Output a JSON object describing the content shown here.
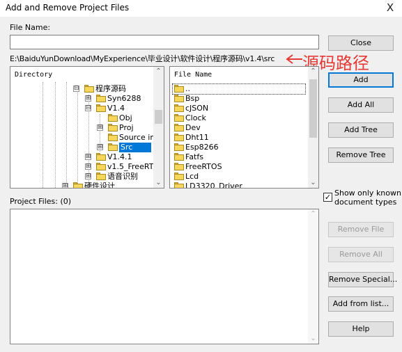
{
  "window": {
    "title": "Add and Remove Project Files",
    "close_glyph": "X"
  },
  "file_name": {
    "label": "File Name:",
    "value": ""
  },
  "path": {
    "text": "E:\\BaiduYunDownload\\MyExperience\\毕业设计\\软件设计\\程序源码\\v1.4\\src",
    "annotation": "源码路径"
  },
  "directory": {
    "header": "Directory",
    "items": [
      {
        "label": "程序源码",
        "expander": "⊟"
      },
      {
        "label": "Syn6288",
        "expander": "⊞"
      },
      {
        "label": "V1.4",
        "expander": "⊟"
      },
      {
        "label": "Obj",
        "expander": ""
      },
      {
        "label": "Proj",
        "expander": "⊞"
      },
      {
        "label": "Source in",
        "expander": ""
      },
      {
        "label": "Src",
        "expander": "⊞"
      },
      {
        "label": "V1.4.1",
        "expander": "⊞"
      },
      {
        "label": "v1.5_FreeRT",
        "expander": "⊞"
      },
      {
        "label": "语音识别",
        "expander": "⊞"
      },
      {
        "label": "硬件设计",
        "expander": "⊞"
      }
    ]
  },
  "files": {
    "header": "File Name",
    "items": [
      "..",
      "Bsp",
      "cJSON",
      "Clock",
      "Dev",
      "Dht11",
      "Esp8266",
      "Fatfs",
      "FreeRTOS",
      "Lcd",
      "LD3320_Driver"
    ]
  },
  "buttons": {
    "close": "Close",
    "add": "Add",
    "add_all": "Add All",
    "add_tree": "Add Tree",
    "remove_tree": "Remove Tree",
    "remove_file": "Remove File",
    "remove_all": "Remove All",
    "remove_special": "Remove Special...",
    "add_from_list": "Add from list...",
    "help": "Help"
  },
  "show_known": {
    "line1": "Show only known",
    "line2": "document types",
    "checked": true,
    "check_glyph": "✓"
  },
  "project_files": {
    "label": "Project Files: (0)"
  },
  "colors": {
    "annotation": "#e53935",
    "selection": "#0078d7",
    "default_button_border": "#0078d7"
  },
  "icons": {
    "folder": "folder-icon",
    "arrow": "left-arrow-icon"
  }
}
